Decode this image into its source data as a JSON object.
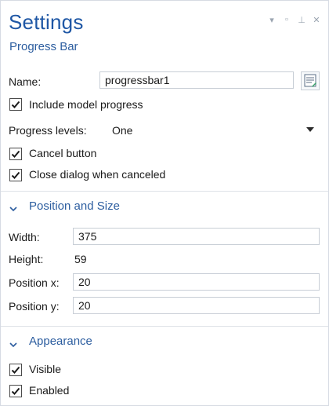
{
  "header": {
    "title": "Settings",
    "subtitle": "Progress Bar"
  },
  "window_controls": [
    "dropdown-icon",
    "maximize-icon",
    "pin-icon",
    "close-icon"
  ],
  "general": {
    "name_label": "Name:",
    "name_value": "progressbar1",
    "include_model_progress": {
      "label": "Include model progress",
      "checked": true
    },
    "progress_levels_label": "Progress levels:",
    "progress_levels_value": "One",
    "cancel_button": {
      "label": "Cancel button",
      "checked": true
    },
    "close_dialog": {
      "label": "Close dialog when canceled",
      "checked": true
    }
  },
  "position_size": {
    "section_title": "Position and Size",
    "width_label": "Width:",
    "width_value": "375",
    "height_label": "Height:",
    "height_value": "59",
    "pos_x_label": "Position x:",
    "pos_x_value": "20",
    "pos_y_label": "Position y:",
    "pos_y_value": "20"
  },
  "appearance": {
    "section_title": "Appearance",
    "visible": {
      "label": "Visible",
      "checked": true
    },
    "enabled": {
      "label": "Enabled",
      "checked": true
    }
  },
  "colors": {
    "accent": "#2c5d9f",
    "title": "#1f57a5",
    "border": "#c8ced6"
  }
}
